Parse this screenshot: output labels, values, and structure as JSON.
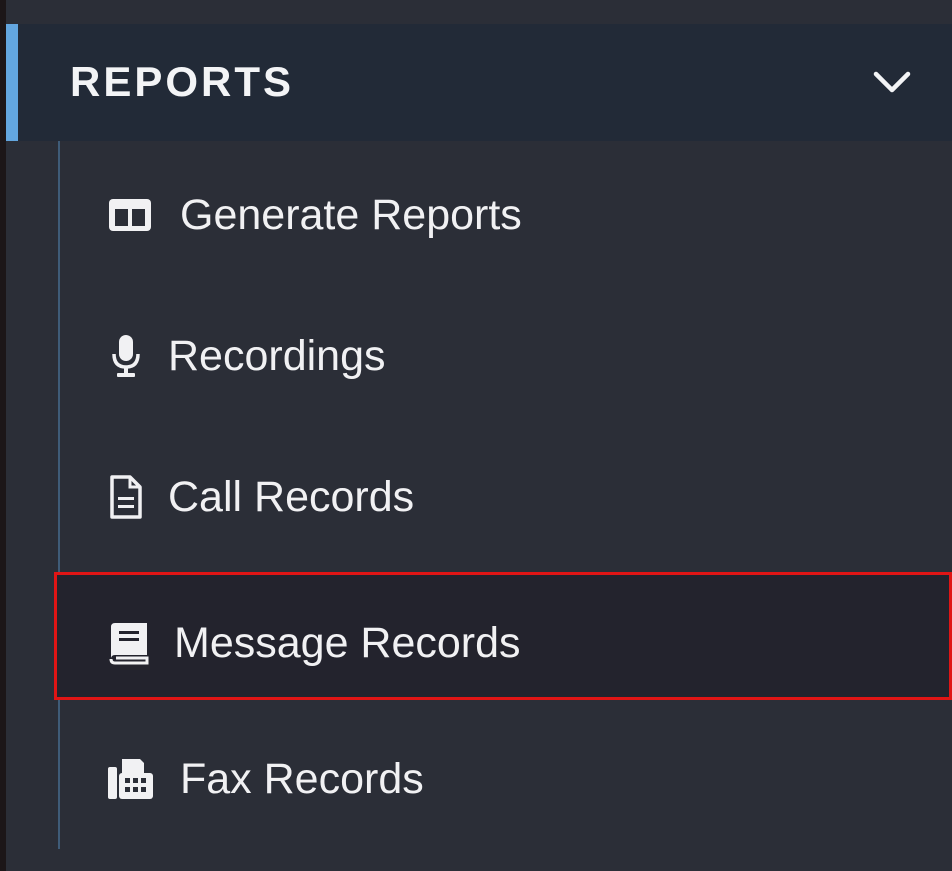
{
  "section": {
    "title": "REPORTS",
    "chevron_icon": "chevron-down-icon"
  },
  "items": [
    {
      "label": "Generate Reports",
      "icon": "columns-icon"
    },
    {
      "label": "Recordings",
      "icon": "microphone-icon"
    },
    {
      "label": "Call Records",
      "icon": "file-text-icon"
    },
    {
      "label": "Message Records",
      "icon": "book-icon",
      "highlighted": true
    },
    {
      "label": "Fax Records",
      "icon": "fax-icon"
    }
  ],
  "colors": {
    "accent": "#63a6df",
    "header_bg": "#222a37",
    "sidebar_bg": "#2b2e37",
    "highlight_border": "#e01515"
  }
}
